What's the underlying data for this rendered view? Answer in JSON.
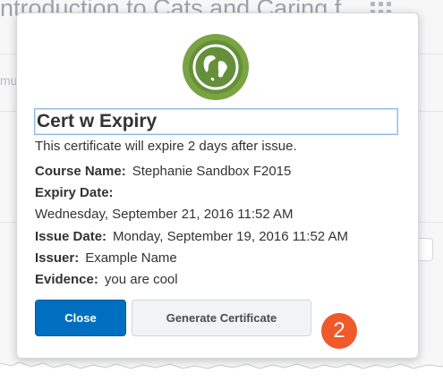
{
  "background": {
    "page_title": "ntroduction to Cats and Caring f",
    "muted_text": "mu"
  },
  "dialog": {
    "badge_icon": "globe-icon",
    "certificate_name": "Cert w Expiry",
    "description": "This certificate will expire 2 days after issue.",
    "fields": {
      "course_label": "Course Name:",
      "course_value": "Stephanie Sandbox F2015",
      "expiry_label": "Expiry Date:",
      "expiry_value": "Wednesday, September 21, 2016 11:52 AM",
      "issue_label": "Issue Date:",
      "issue_value": "Monday, September 19, 2016 11:52 AM",
      "issuer_label": "Issuer:",
      "issuer_value": "Example Name",
      "evidence_label": "Evidence:",
      "evidence_value": "you are cool"
    },
    "buttons": {
      "close": "Close",
      "generate": "Generate Certificate"
    }
  },
  "step_badge": "2",
  "colors": {
    "primary": "#006fbf",
    "badge_green": "#7aa442",
    "step_orange": "#f0592a"
  }
}
